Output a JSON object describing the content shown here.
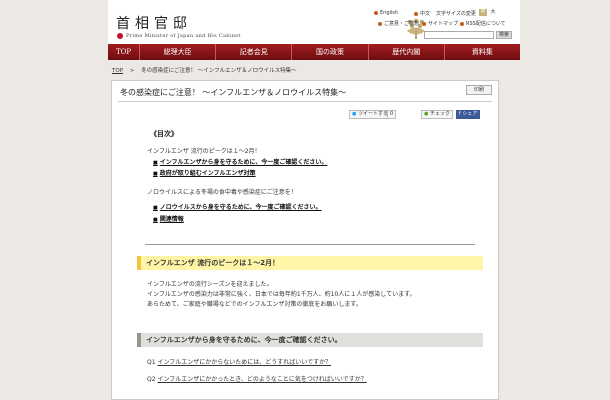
{
  "header": {
    "title": "首相官邸",
    "subtitle": "Prime Minister of Japan and His Cabinet",
    "lang_en": "English",
    "lang_cn": "中文",
    "font_size_label": "文字サイズの変更",
    "size_medium": "中",
    "size_large": "大",
    "feedback": "ご意見・ご感想",
    "sitemap": "サイトマップ",
    "rss": "RSS配信について",
    "search_button": "検索"
  },
  "nav": {
    "items": [
      "TOP",
      "総理大臣",
      "記者会見",
      "国の政策",
      "歴代内閣",
      "資料集"
    ]
  },
  "breadcrumb": {
    "home": "TOP",
    "sep": ">",
    "current": "冬の感染症にご注意！ ～インフルエンザ＆ノロウイルス特集～"
  },
  "article": {
    "title": "冬の感染症にご注意！ ～インフルエンザ＆ノロウイルス特集～",
    "print": "印刷",
    "share": {
      "tweet": "ツイートする",
      "tweet_count": "0",
      "check": "チェック",
      "fb": "シェア"
    },
    "toc_heading": "《目次》",
    "toc_flu_intro": "インフルエンザ 流行のピークは１～2月！",
    "toc_flu_links": [
      "インフルエンザから身を守るために、今一度ご確認ください。",
      "政府が取り組むインフルエンザ対策"
    ],
    "toc_noro_intro": "ノロウイルスによる冬場の食中毒や感染症にご注意を！",
    "toc_noro_links": [
      "ノロウイルスから身を守るために、今一度ご確認ください。",
      "関連情報"
    ],
    "section1_heading": "インフルエンザ 流行のピークは１～2月！",
    "section1_body": [
      "インフルエンザの流行シーズンを迎えました。",
      "インフルエンザの感染力は非常に強く、日本では毎年約1千万人、約10人に１人が感染しています。",
      "あらためて、ご家庭や職場などでのインフルエンザ対策の徹底をお願いします。"
    ],
    "section2_heading": "インフルエンザから身を守るために、今一度ご確認ください。",
    "questions": [
      {
        "num": "Q1",
        "text": "インフルエンザにかからないためには、どうすればいいですか？"
      },
      {
        "num": "Q2",
        "text": "インフルエンザにかかったとき、どのようなことに気をつければいいですか？"
      }
    ]
  },
  "colors": {
    "nav_bg": "#8b1418",
    "yellow_bg": "#fff5a6",
    "flag_red": "#c8102e"
  }
}
